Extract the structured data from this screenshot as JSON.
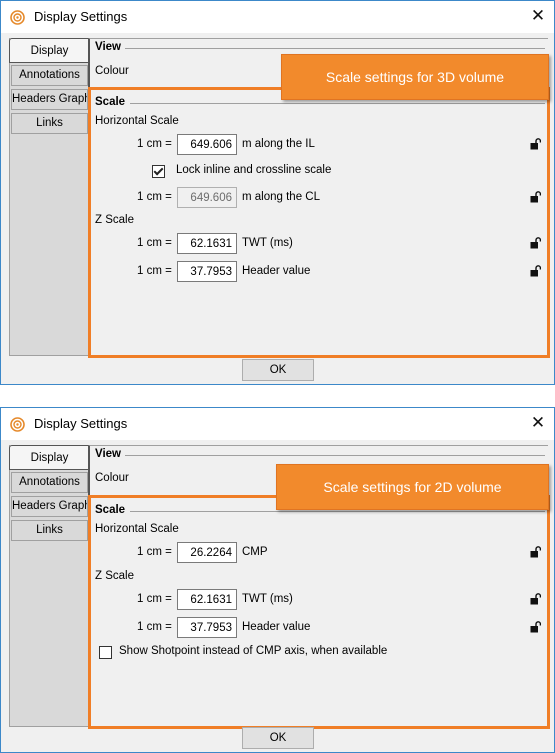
{
  "dialogs": [
    {
      "title": "Display Settings",
      "close_glyph": "✕",
      "tabs": [
        {
          "label": "Display",
          "active": true
        },
        {
          "label": "Annotations"
        },
        {
          "label": "Headers Graph"
        },
        {
          "label": "Links"
        }
      ],
      "view_heading": "View",
      "colour_label": "Colour",
      "scale_heading": "Scale",
      "horizontal_scale_label": "Horizontal Scale",
      "unit_label": "1 cm =",
      "il_value": "649.606",
      "il_label": "m along the IL",
      "lock_checkbox_label": "Lock inline and crossline scale",
      "lock_checked": true,
      "cl_value": "649.606",
      "cl_label": "m along the CL",
      "z_scale_label": "Z Scale",
      "twt_value": "62.1631",
      "twt_label": "TWT (ms)",
      "header_value": "37.7953",
      "header_label": "Header value",
      "callout_text": "Scale settings for 3D volume",
      "ok_label": "OK"
    },
    {
      "title": "Display Settings",
      "close_glyph": "✕",
      "tabs": [
        {
          "label": "Display",
          "active": true
        },
        {
          "label": "Annotations"
        },
        {
          "label": "Headers Graph"
        },
        {
          "label": "Links"
        }
      ],
      "view_heading": "View",
      "colour_label": "Colour",
      "scale_heading": "Scale",
      "horizontal_scale_label": "Horizontal Scale",
      "unit_label": "1 cm =",
      "cmp_value": "26.2264",
      "cmp_label": "CMP",
      "z_scale_label": "Z Scale",
      "twt_value": "62.1631",
      "twt_label": "TWT (ms)",
      "header_value": "37.7953",
      "header_label": "Header value",
      "shotpoint_checkbox_label": "Show Shotpoint instead of CMP axis, when available",
      "shotpoint_checked": false,
      "callout_text": "Scale settings for 2D volume",
      "ok_label": "OK"
    }
  ],
  "colors": {
    "accent_orange": "#f28a2c",
    "highlight_border": "#f07e26",
    "window_border": "#3c88c9"
  },
  "icons": {
    "app": "seismic-target-icon",
    "lock": "unlocked-padlock-icon",
    "close": "close-icon"
  }
}
